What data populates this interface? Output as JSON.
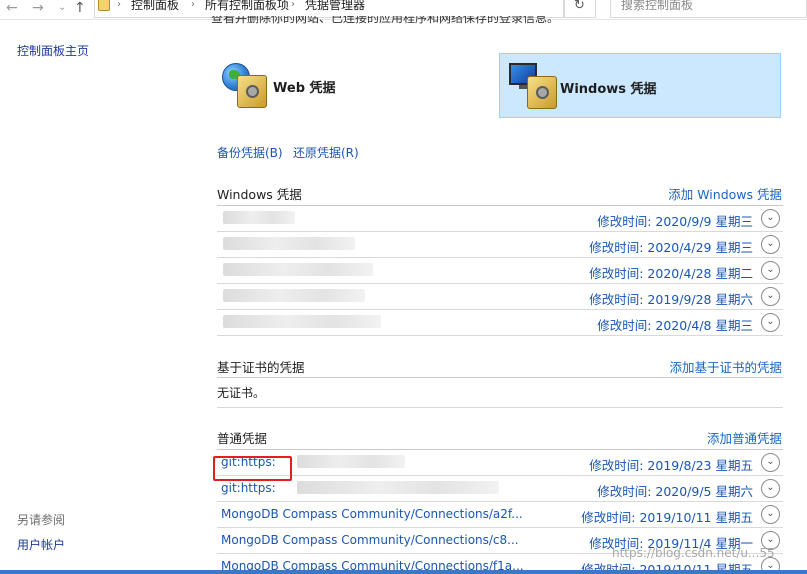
{
  "address_bar": {
    "breadcrumbs": [
      "控制面板",
      "所有控制面板项",
      "凭据管理器"
    ],
    "search_placeholder": "搜索控制面板"
  },
  "left_pane": {
    "home_link": "控制面板主页",
    "see_also_title": "另请参阅",
    "see_also_items": [
      "用户帐户"
    ]
  },
  "intro_text": "查看并删除你的网站、已连接的应用程序和网络保存的登录信息。",
  "tiles": {
    "web_label": "Web 凭据",
    "windows_label": "Windows 凭据",
    "selected": "windows"
  },
  "actions": {
    "backup": "备份凭据(B)",
    "restore": "还原凭据(R)"
  },
  "sections": {
    "windows": {
      "title": "Windows 凭据",
      "add_label": "添加 Windows 凭据",
      "rows": [
        {
          "name": "",
          "modified": "修改时间:  2020/9/9 星期三"
        },
        {
          "name": "",
          "modified": "修改时间:  2020/4/29 星期三"
        },
        {
          "name": "",
          "modified": "修改时间:  2020/4/28 星期二"
        },
        {
          "name": "",
          "modified": "修改时间:  2019/9/28 星期六"
        },
        {
          "name": "",
          "modified": "修改时间:  2020/4/8 星期三"
        }
      ]
    },
    "certificate": {
      "title": "基于证书的凭据",
      "add_label": "添加基于证书的凭据",
      "empty_text": "无证书。"
    },
    "generic": {
      "title": "普通凭据",
      "add_label": "添加普通凭据",
      "rows": [
        {
          "name": "git:https:",
          "modified": "修改时间:  2019/8/23 星期五"
        },
        {
          "name": "git:https:",
          "modified": "修改时间:  2020/9/5 星期六"
        },
        {
          "name": "MongoDB Compass Community/Connections/a2f...",
          "modified": "修改时间:  2019/10/11 星期五"
        },
        {
          "name": "MongoDB Compass Community/Connections/c8...",
          "modified": "修改时间:  2019/11/4 星期一"
        },
        {
          "name": "MongoDB Compass Community/Connections/f1a...",
          "modified": "修改时间:  2019/10/11 星期五"
        }
      ]
    }
  },
  "watermark": "https://blog.csdn.net/u...55",
  "colors": {
    "link": "#1a55b5",
    "selected_tile": "#cce8ff",
    "highlight_box": "#e02020"
  }
}
